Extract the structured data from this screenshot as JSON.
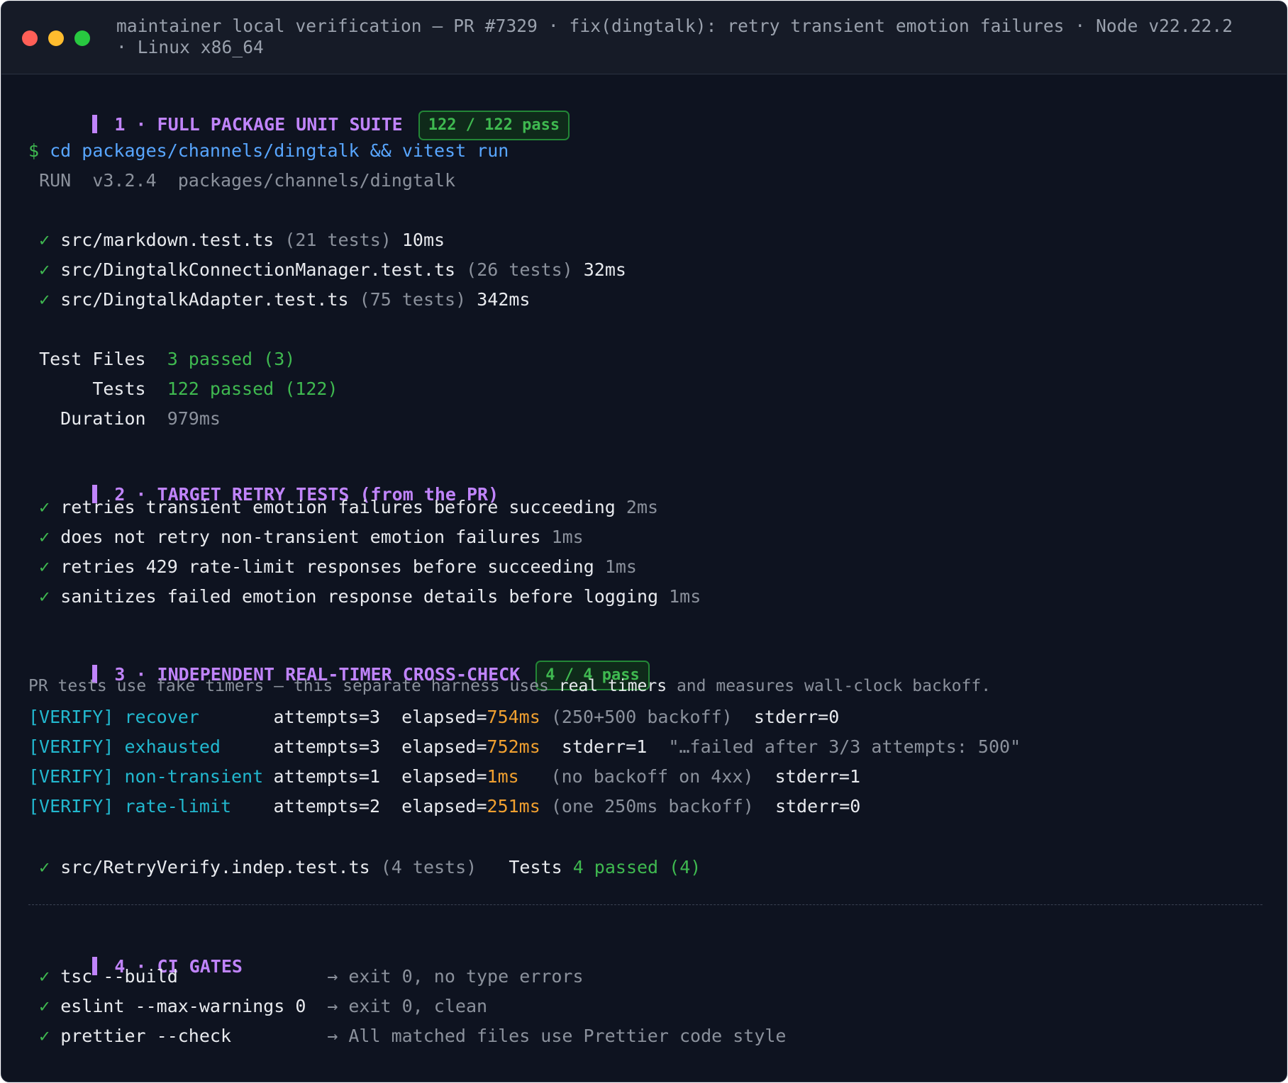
{
  "window": {
    "title_line1": "maintainer local verification — PR #7329 · fix(dingtalk): retry transient emotion failures · Node v22.22.2",
    "title_line2": "· Linux x86_64"
  },
  "section1": {
    "heading": "1 · FULL PACKAGE UNIT SUITE",
    "badge": "122 / 122 pass",
    "prompt": "$",
    "command": "cd packages/channels/dingtalk && vitest run",
    "run_label": "RUN",
    "run_version": "v3.2.4",
    "run_path": "packages/channels/dingtalk",
    "files": [
      {
        "check": "✓",
        "name": "src/markdown.test.ts",
        "count": "(21 tests)",
        "time": "10ms"
      },
      {
        "check": "✓",
        "name": "src/DingtalkConnectionManager.test.ts",
        "count": "(26 tests)",
        "time": "32ms"
      },
      {
        "check": "✓",
        "name": "src/DingtalkAdapter.test.ts",
        "count": "(75 tests)",
        "time": "342ms"
      }
    ],
    "summary": {
      "files_label": "Test Files",
      "files_value": "3 passed (3)",
      "tests_label": "Tests",
      "tests_value": "122 passed (122)",
      "duration_label": "Duration",
      "duration_value": "979ms"
    }
  },
  "section2": {
    "heading": "2 · TARGET RETRY TESTS (from the PR)",
    "tests": [
      {
        "check": "✓",
        "name": "retries transient emotion failures before succeeding",
        "time": "2ms"
      },
      {
        "check": "✓",
        "name": "does not retry non-transient emotion failures",
        "time": "1ms"
      },
      {
        "check": "✓",
        "name": "retries 429 rate-limit responses before succeeding",
        "time": "1ms"
      },
      {
        "check": "✓",
        "name": "sanitizes failed emotion response details before logging",
        "time": "1ms"
      }
    ]
  },
  "section3": {
    "heading": "3 · INDEPENDENT REAL-TIMER CROSS-CHECK",
    "badge": "4 / 4 pass",
    "note_pre": "PR tests use fake timers — this separate harness uses",
    "note_hl": "real timers",
    "note_post": "and measures wall-clock backoff.",
    "rows": [
      {
        "tag": "[VERIFY]",
        "name": "recover",
        "attempts": "attempts=3",
        "elapsed_label": "elapsed=",
        "elapsed": "754ms",
        "detail": "(250+500 backoff)",
        "stderr": "stderr=0",
        "extra": ""
      },
      {
        "tag": "[VERIFY]",
        "name": "exhausted",
        "attempts": "attempts=3",
        "elapsed_label": "elapsed=",
        "elapsed": "752ms",
        "detail": "",
        "stderr": "stderr=1",
        "extra": "\"…failed after 3/3 attempts: 500\""
      },
      {
        "tag": "[VERIFY]",
        "name": "non-transient",
        "attempts": "attempts=1",
        "elapsed_label": "elapsed=",
        "elapsed": "1ms",
        "detail": "(no backoff on 4xx)",
        "stderr": "stderr=1",
        "extra": ""
      },
      {
        "tag": "[VERIFY]",
        "name": "rate-limit",
        "attempts": "attempts=2",
        "elapsed_label": "elapsed=",
        "elapsed": "251ms",
        "detail": "(one 250ms backoff)",
        "stderr": "stderr=0",
        "extra": ""
      }
    ],
    "result": {
      "check": "✓",
      "file": "src/RetryVerify.indep.test.ts",
      "count": "(4 tests)",
      "tests_label": "Tests",
      "tests_value": "4 passed (4)"
    }
  },
  "section4": {
    "heading": "4 · CI GATES",
    "gates": [
      {
        "check": "✓",
        "cmd": "tsc --build",
        "arrow": "→",
        "result": "exit 0, no type errors"
      },
      {
        "check": "✓",
        "cmd": "eslint --max-warnings 0",
        "arrow": "→",
        "result": "exit 0, clean"
      },
      {
        "check": "✓",
        "cmd": "prettier --check",
        "arrow": "→",
        "result": "All matched files use Prettier code style"
      }
    ]
  },
  "colors": {
    "background": "#0e1320",
    "heading": "#c084fc",
    "pass": "#3fb950",
    "command": "#58a6ff",
    "verify": "#22b8cf",
    "elapsed": "#f0a030"
  }
}
